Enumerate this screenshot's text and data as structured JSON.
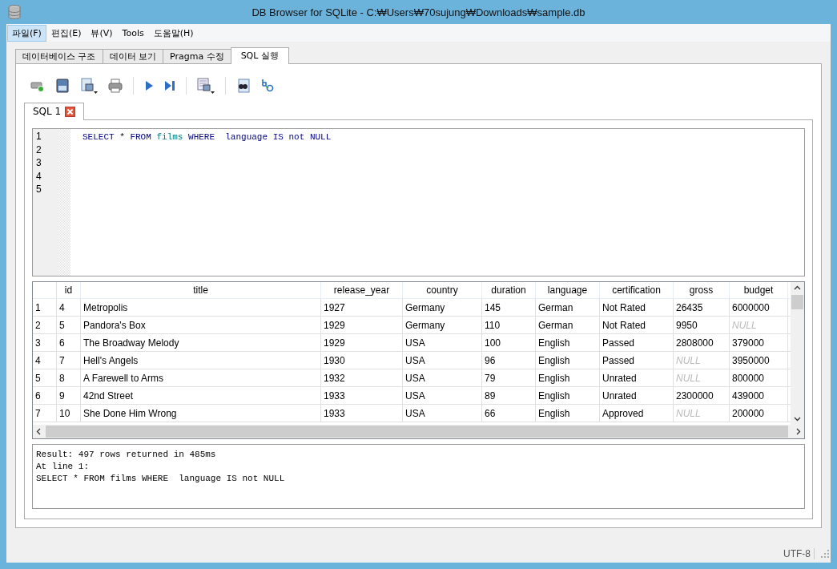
{
  "window": {
    "title": "DB Browser for SQLite - C:₩Users₩70sujung₩Downloads₩sample.db"
  },
  "menu": [
    {
      "label": "파일(F)",
      "highlighted": true
    },
    {
      "label": "편집(E)",
      "highlighted": false
    },
    {
      "label": "뷰(V)",
      "highlighted": false
    },
    {
      "label": "Tools",
      "highlighted": false
    },
    {
      "label": "도움말(H)",
      "highlighted": false
    }
  ],
  "tabs": [
    {
      "label": "데이터베이스 구조",
      "selected": false
    },
    {
      "label": "데이터 보기",
      "selected": false
    },
    {
      "label": "Pragma 수정",
      "selected": false
    },
    {
      "label": "SQL 실행",
      "selected": true
    }
  ],
  "editor_tabs": [
    {
      "label": "SQL 1",
      "selected": true
    }
  ],
  "editor": {
    "line_numbers": [
      "1",
      "2",
      "3",
      "4",
      "5"
    ],
    "tokens": [
      {
        "text": "SELECT ",
        "kind": "keyword"
      },
      {
        "text": "* ",
        "kind": "plain"
      },
      {
        "text": "FROM ",
        "kind": "keyword"
      },
      {
        "text": "films ",
        "kind": "table"
      },
      {
        "text": "WHERE  ",
        "kind": "keyword"
      },
      {
        "text": "language ",
        "kind": "keyword"
      },
      {
        "text": "IS ",
        "kind": "keyword"
      },
      {
        "text": "not ",
        "kind": "keyword"
      },
      {
        "text": "NULL",
        "kind": "keyword"
      }
    ]
  },
  "results": {
    "columns": [
      "id",
      "title",
      "release_year",
      "country",
      "duration",
      "language",
      "certification",
      "gross",
      "budget"
    ],
    "rows": [
      {
        "number": "1",
        "cells": [
          {
            "text": "4",
            "null": false
          },
          {
            "text": "Metropolis",
            "null": false
          },
          {
            "text": "1927",
            "null": false
          },
          {
            "text": "Germany",
            "null": false
          },
          {
            "text": "145",
            "null": false
          },
          {
            "text": "German",
            "null": false
          },
          {
            "text": "Not Rated",
            "null": false
          },
          {
            "text": "26435",
            "null": false
          },
          {
            "text": "6000000",
            "null": false
          }
        ]
      },
      {
        "number": "2",
        "cells": [
          {
            "text": "5",
            "null": false
          },
          {
            "text": "Pandora's Box",
            "null": false
          },
          {
            "text": "1929",
            "null": false
          },
          {
            "text": "Germany",
            "null": false
          },
          {
            "text": "110",
            "null": false
          },
          {
            "text": "German",
            "null": false
          },
          {
            "text": "Not Rated",
            "null": false
          },
          {
            "text": "9950",
            "null": false
          },
          {
            "text": "NULL",
            "null": true
          }
        ]
      },
      {
        "number": "3",
        "cells": [
          {
            "text": "6",
            "null": false
          },
          {
            "text": "The Broadway Melody",
            "null": false
          },
          {
            "text": "1929",
            "null": false
          },
          {
            "text": "USA",
            "null": false
          },
          {
            "text": "100",
            "null": false
          },
          {
            "text": "English",
            "null": false
          },
          {
            "text": "Passed",
            "null": false
          },
          {
            "text": "2808000",
            "null": false
          },
          {
            "text": "379000",
            "null": false
          }
        ]
      },
      {
        "number": "4",
        "cells": [
          {
            "text": "7",
            "null": false
          },
          {
            "text": "Hell's Angels",
            "null": false
          },
          {
            "text": "1930",
            "null": false
          },
          {
            "text": "USA",
            "null": false
          },
          {
            "text": "96",
            "null": false
          },
          {
            "text": "English",
            "null": false
          },
          {
            "text": "Passed",
            "null": false
          },
          {
            "text": "NULL",
            "null": true
          },
          {
            "text": "3950000",
            "null": false
          }
        ]
      },
      {
        "number": "5",
        "cells": [
          {
            "text": "8",
            "null": false
          },
          {
            "text": "A Farewell to Arms",
            "null": false
          },
          {
            "text": "1932",
            "null": false
          },
          {
            "text": "USA",
            "null": false
          },
          {
            "text": "79",
            "null": false
          },
          {
            "text": "English",
            "null": false
          },
          {
            "text": "Unrated",
            "null": false
          },
          {
            "text": "NULL",
            "null": true
          },
          {
            "text": "800000",
            "null": false
          }
        ]
      },
      {
        "number": "6",
        "cells": [
          {
            "text": "9",
            "null": false
          },
          {
            "text": "42nd Street",
            "null": false
          },
          {
            "text": "1933",
            "null": false
          },
          {
            "text": "USA",
            "null": false
          },
          {
            "text": "89",
            "null": false
          },
          {
            "text": "English",
            "null": false
          },
          {
            "text": "Unrated",
            "null": false
          },
          {
            "text": "2300000",
            "null": false
          },
          {
            "text": "439000",
            "null": false
          }
        ]
      },
      {
        "number": "7",
        "cells": [
          {
            "text": "10",
            "null": false
          },
          {
            "text": "She Done Him Wrong",
            "null": false
          },
          {
            "text": "1933",
            "null": false
          },
          {
            "text": "USA",
            "null": false
          },
          {
            "text": "66",
            "null": false
          },
          {
            "text": "English",
            "null": false
          },
          {
            "text": "Approved",
            "null": false
          },
          {
            "text": "NULL",
            "null": true
          },
          {
            "text": "200000",
            "null": false
          }
        ]
      }
    ]
  },
  "message": [
    "Result: 497 rows returned in 485ms",
    "At line 1:",
    "SELECT * FROM films WHERE  language IS not NULL"
  ],
  "status_bar": {
    "encoding": "UTF-8"
  }
}
